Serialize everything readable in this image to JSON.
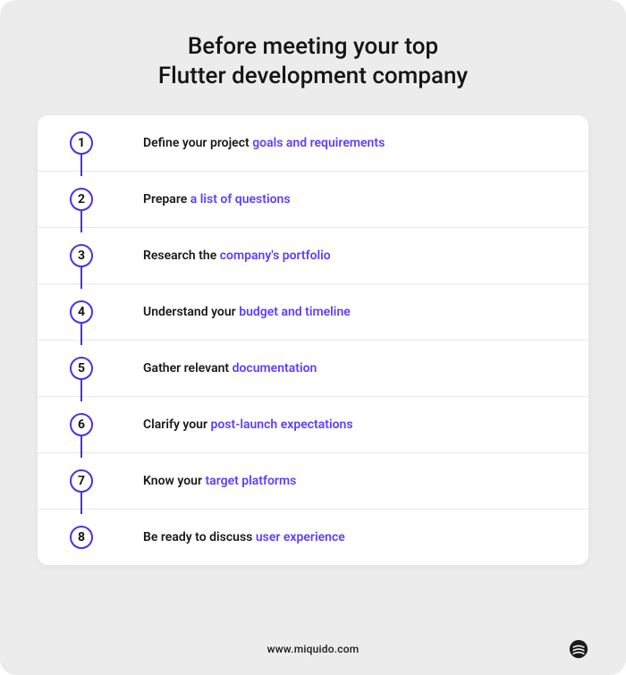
{
  "title_line1": "Before meeting your top",
  "title_line2": "Flutter development company",
  "colors": {
    "accent": "#5d3eff",
    "circle_border": "#4a34e0",
    "bg_outer": "#ececec",
    "bg_inner": "#ffffff"
  },
  "steps": [
    {
      "num": "1",
      "pre": "Define your project ",
      "hl": "goals and requirements",
      "post": ""
    },
    {
      "num": "2",
      "pre": "Prepare ",
      "hl": "a list of questions",
      "post": ""
    },
    {
      "num": "3",
      "pre": "Research the ",
      "hl": "company's portfolio",
      "post": ""
    },
    {
      "num": "4",
      "pre": "Understand your ",
      "hl": "budget and timeline",
      "post": ""
    },
    {
      "num": "5",
      "pre": "Gather relevant ",
      "hl": "documentation",
      "post": ""
    },
    {
      "num": "6",
      "pre": "Clarify your ",
      "hl": "post-launch expectations",
      "post": ""
    },
    {
      "num": "7",
      "pre": "Know your ",
      "hl": "target platforms",
      "post": ""
    },
    {
      "num": "8",
      "pre": "Be ready to discuss ",
      "hl": "user experience",
      "post": ""
    }
  ],
  "footer": {
    "domain": "www.miquido.com"
  }
}
